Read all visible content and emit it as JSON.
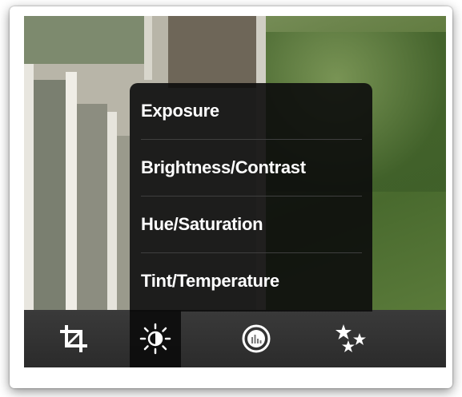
{
  "adjust_menu": {
    "items": [
      {
        "label": "Exposure"
      },
      {
        "label": "Brightness/Contrast"
      },
      {
        "label": "Hue/Saturation"
      },
      {
        "label": "Tint/Temperature"
      }
    ]
  },
  "toolbar": {
    "tools": [
      {
        "icon": "crop-icon",
        "active": false
      },
      {
        "icon": "brightness-sun-icon",
        "active": true
      },
      {
        "icon": "filter-circle-icon",
        "active": false
      },
      {
        "icon": "effects-stars-icon",
        "active": false
      }
    ]
  },
  "colors": {
    "menu_bg": "#0c0c0c",
    "toolbar_bg": "#2f2f2f",
    "text": "#ffffff"
  }
}
